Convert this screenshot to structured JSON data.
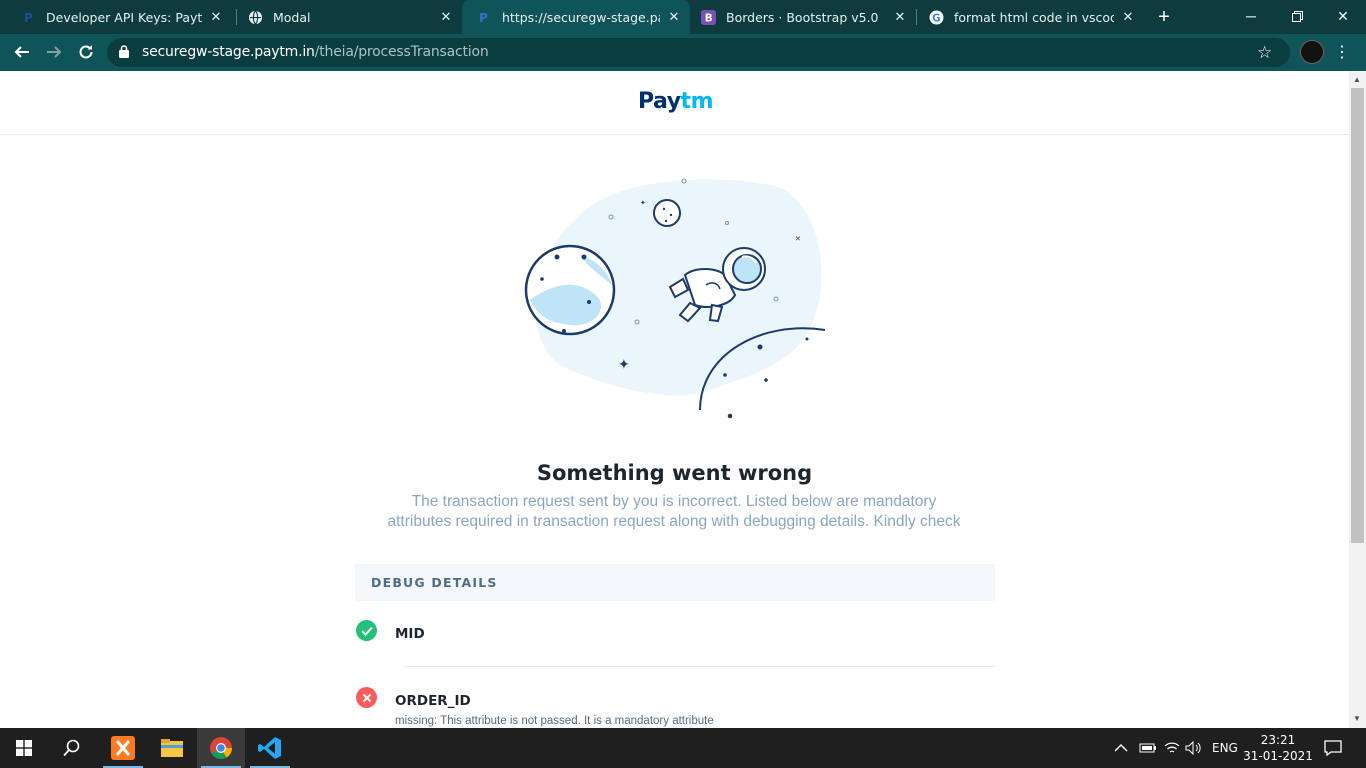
{
  "browser": {
    "tabs": [
      {
        "title": "Developer API Keys: Paytm for",
        "icon": "paytm-favicon"
      },
      {
        "title": "Modal",
        "icon": "globe-icon"
      },
      {
        "title": "https://securegw-stage.paytm.",
        "icon": "paytm-favicon"
      },
      {
        "title": "Borders · Bootstrap v5.0",
        "icon": "bootstrap-icon"
      },
      {
        "title": "format html code in vscode - G",
        "icon": "google-icon"
      }
    ],
    "active_tab": 2,
    "url_host": "securegw-stage.paytm.in",
    "url_path": "/theia/processTransaction",
    "accent": "#0e5458"
  },
  "page": {
    "logo": {
      "part1": "Pay",
      "part2": "tm"
    },
    "heading": "Something went wrong",
    "message_line1": "The transaction request sent by you is incorrect. Listed below are mandatory",
    "message_line2": "attributes required in transaction request along with debugging details. Kindly check",
    "debug_title": "DEBUG DETAILS",
    "debug_rows": [
      {
        "name": "MID",
        "status": "ok",
        "note": ""
      },
      {
        "name": "ORDER_ID",
        "status": "error",
        "note": "missing: This attribute is not passed. It is a mandatory attribute"
      }
    ],
    "colors": {
      "ok": "#21c17a",
      "error": "#fd5c5c",
      "logo_dark": "#002e6e",
      "logo_light": "#00baf2"
    }
  },
  "taskbar": {
    "apps": [
      "windows-start-icon",
      "search-icon",
      "xampp-icon",
      "file-explorer-icon",
      "chrome-icon",
      "vscode-icon"
    ],
    "language": "ENG",
    "time": "23:21",
    "date": "31-01-2021"
  }
}
